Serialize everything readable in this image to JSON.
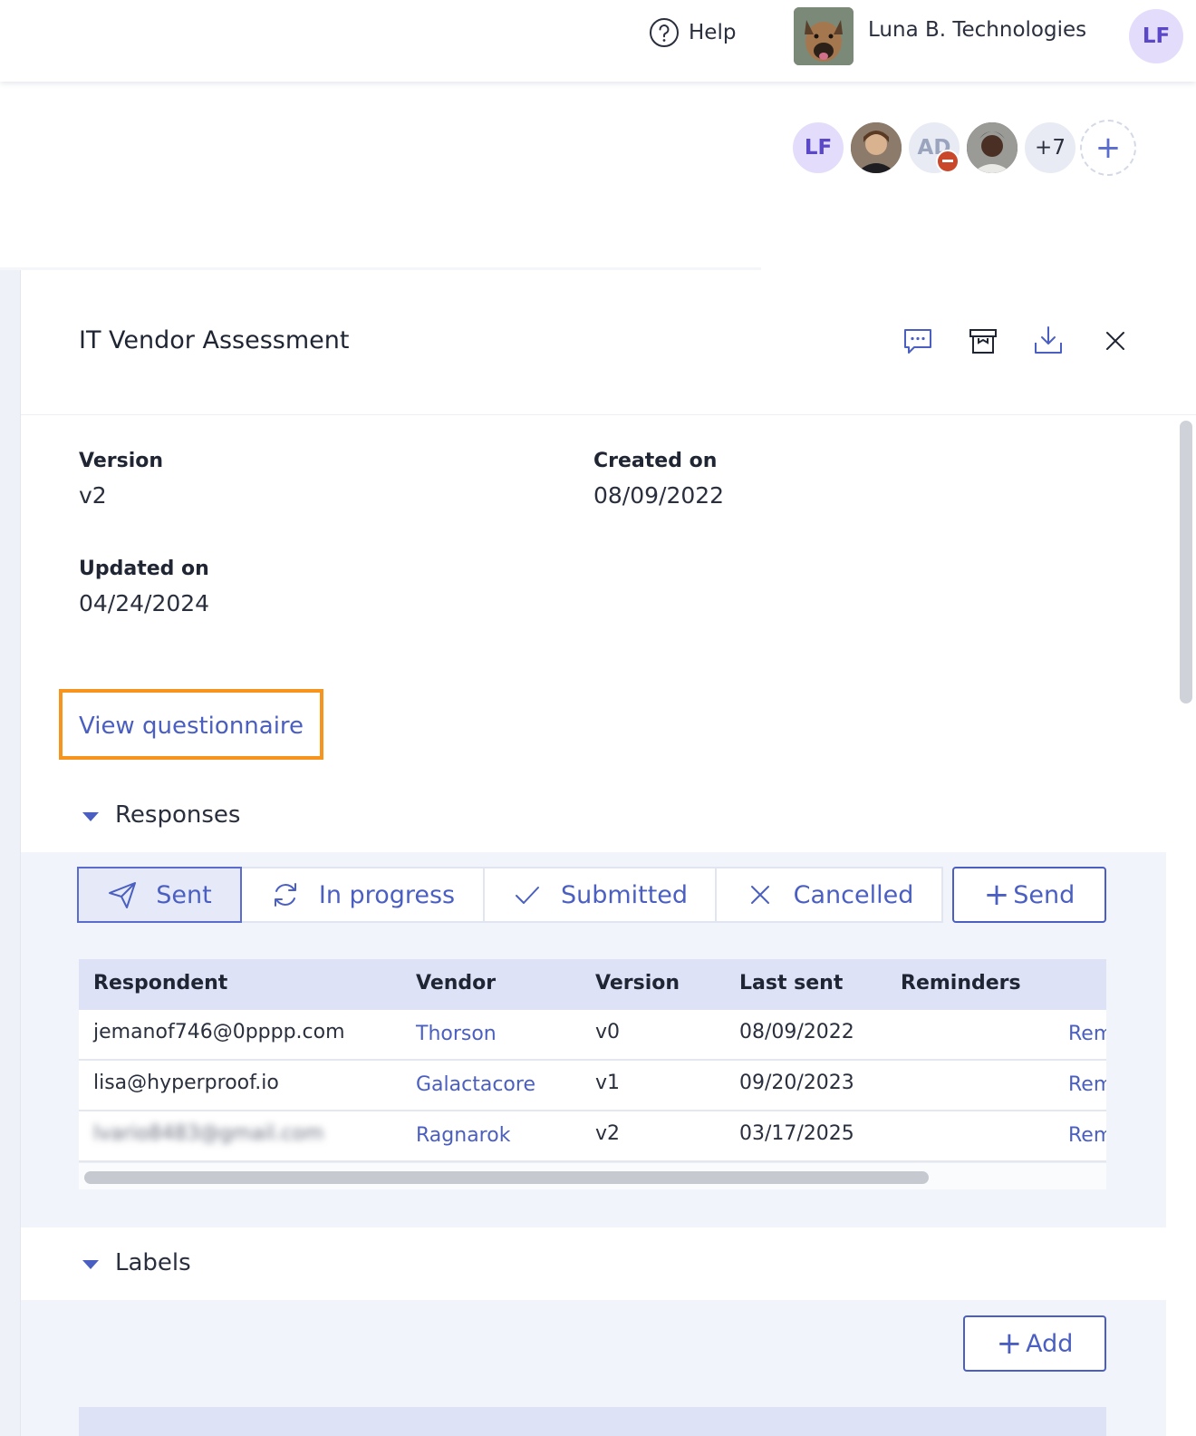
{
  "topbar": {
    "help_label": "Help",
    "org_name": "Luna B. Technologies",
    "user_initials": "LF"
  },
  "collaborators": {
    "first_initials": "LF",
    "third_initials": "AD",
    "more_count": "+7",
    "add_symbol": "+"
  },
  "drawer": {
    "title": "IT Vendor Assessment",
    "version_label": "Version",
    "version_value": "v2",
    "created_label": "Created on",
    "created_value": "08/09/2022",
    "updated_label": "Updated on",
    "updated_value": "04/24/2024",
    "view_questionnaire": "View questionnaire"
  },
  "responses": {
    "heading": "Responses",
    "tabs": [
      {
        "label": "Sent",
        "icon": "paper-plane-icon"
      },
      {
        "label": "In progress",
        "icon": "refresh-icon"
      },
      {
        "label": "Submitted",
        "icon": "check-icon"
      },
      {
        "label": "Cancelled",
        "icon": "x-icon"
      }
    ],
    "send_label": "Send",
    "columns": [
      "Respondent",
      "Vendor",
      "Version",
      "Last sent",
      "Reminders"
    ],
    "rows": [
      {
        "respondent": "jemanof746@0pppp.com",
        "vendor": "Thorson",
        "version": "v0",
        "last_sent": "08/09/2022",
        "action": "Rem"
      },
      {
        "respondent": "lisa@hyperproof.io",
        "vendor": "Galactacore",
        "version": "v1",
        "last_sent": "09/20/2023",
        "action": "Rem"
      },
      {
        "respondent": "lvario8483@gmail.com",
        "vendor": "Ragnarok",
        "version": "v2",
        "last_sent": "03/17/2025",
        "action": "Rem"
      }
    ]
  },
  "labels": {
    "heading": "Labels",
    "add_label": "Add"
  },
  "colors": {
    "accent": "#4a5fc1",
    "highlight": "#f7941d",
    "band": "#f1f4fb",
    "table_header": "#dde2f7"
  }
}
